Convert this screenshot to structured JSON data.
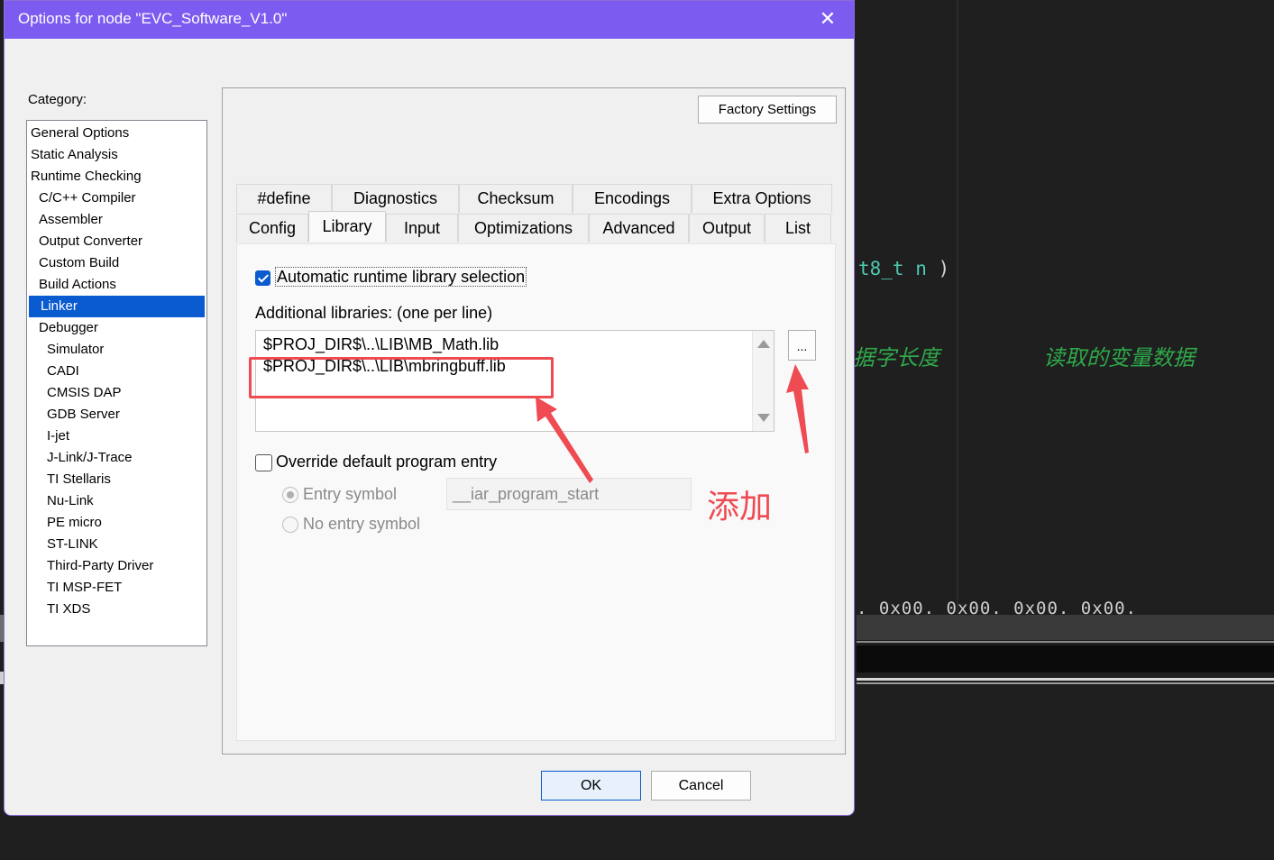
{
  "background_editor": {
    "code_type": "t8_t n",
    "code_paren": ")",
    "comment_1": "据字长度",
    "comment_2": "读取的变量数据",
    "hex_row": ". 0x00. 0x00. 0x00. 0x00."
  },
  "dialog": {
    "title": "Options for node \"EVC_Software_V1.0\"",
    "close_glyph": "✕"
  },
  "category": {
    "label": "Category:",
    "items": [
      {
        "label": "General Options",
        "level": 0
      },
      {
        "label": "Static Analysis",
        "level": 0
      },
      {
        "label": "Runtime Checking",
        "level": 0
      },
      {
        "label": "C/C++ Compiler",
        "level": 1
      },
      {
        "label": "Assembler",
        "level": 1
      },
      {
        "label": "Output Converter",
        "level": 1
      },
      {
        "label": "Custom Build",
        "level": 1
      },
      {
        "label": "Build Actions",
        "level": 1
      },
      {
        "label": "Linker",
        "level": 1,
        "selected": true
      },
      {
        "label": "Debugger",
        "level": 1
      },
      {
        "label": "Simulator",
        "level": 2
      },
      {
        "label": "CADI",
        "level": 2
      },
      {
        "label": "CMSIS DAP",
        "level": 2
      },
      {
        "label": "GDB Server",
        "level": 2
      },
      {
        "label": "I-jet",
        "level": 2
      },
      {
        "label": "J-Link/J-Trace",
        "level": 2
      },
      {
        "label": "TI Stellaris",
        "level": 2
      },
      {
        "label": "Nu-Link",
        "level": 2
      },
      {
        "label": "PE micro",
        "level": 2
      },
      {
        "label": "ST-LINK",
        "level": 2
      },
      {
        "label": "Third-Party Driver",
        "level": 2
      },
      {
        "label": "TI MSP-FET",
        "level": 2
      },
      {
        "label": "TI XDS",
        "level": 2
      }
    ]
  },
  "factory_settings_label": "Factory Settings",
  "tabs": {
    "row1": [
      "#define",
      "Diagnostics",
      "Checksum",
      "Encodings",
      "Extra Options"
    ],
    "row2": [
      "Config",
      "Library",
      "Input",
      "Optimizations",
      "Advanced",
      "Output",
      "List"
    ],
    "active": "Library"
  },
  "library": {
    "auto_runtime_label": "Automatic runtime library selection",
    "auto_runtime_checked": true,
    "additional_libs_label": "Additional libraries: (one per line)",
    "libraries": [
      "$PROJ_DIR$\\..\\LIB\\MB_Math.lib",
      "$PROJ_DIR$\\..\\LIB\\mbringbuff.lib"
    ],
    "browse_label": "...",
    "override_label": "Override default program entry",
    "override_checked": false,
    "entry_symbol_label": "Entry symbol",
    "entry_symbol_value": "__iar_program_start",
    "no_entry_symbol_label": "No entry symbol"
  },
  "buttons": {
    "ok": "OK",
    "cancel": "Cancel"
  },
  "annotation": {
    "text": "添加",
    "color": "#ee4b52"
  },
  "colors": {
    "titlebar": "#7c5cf0",
    "selection": "#0a5bd0"
  }
}
